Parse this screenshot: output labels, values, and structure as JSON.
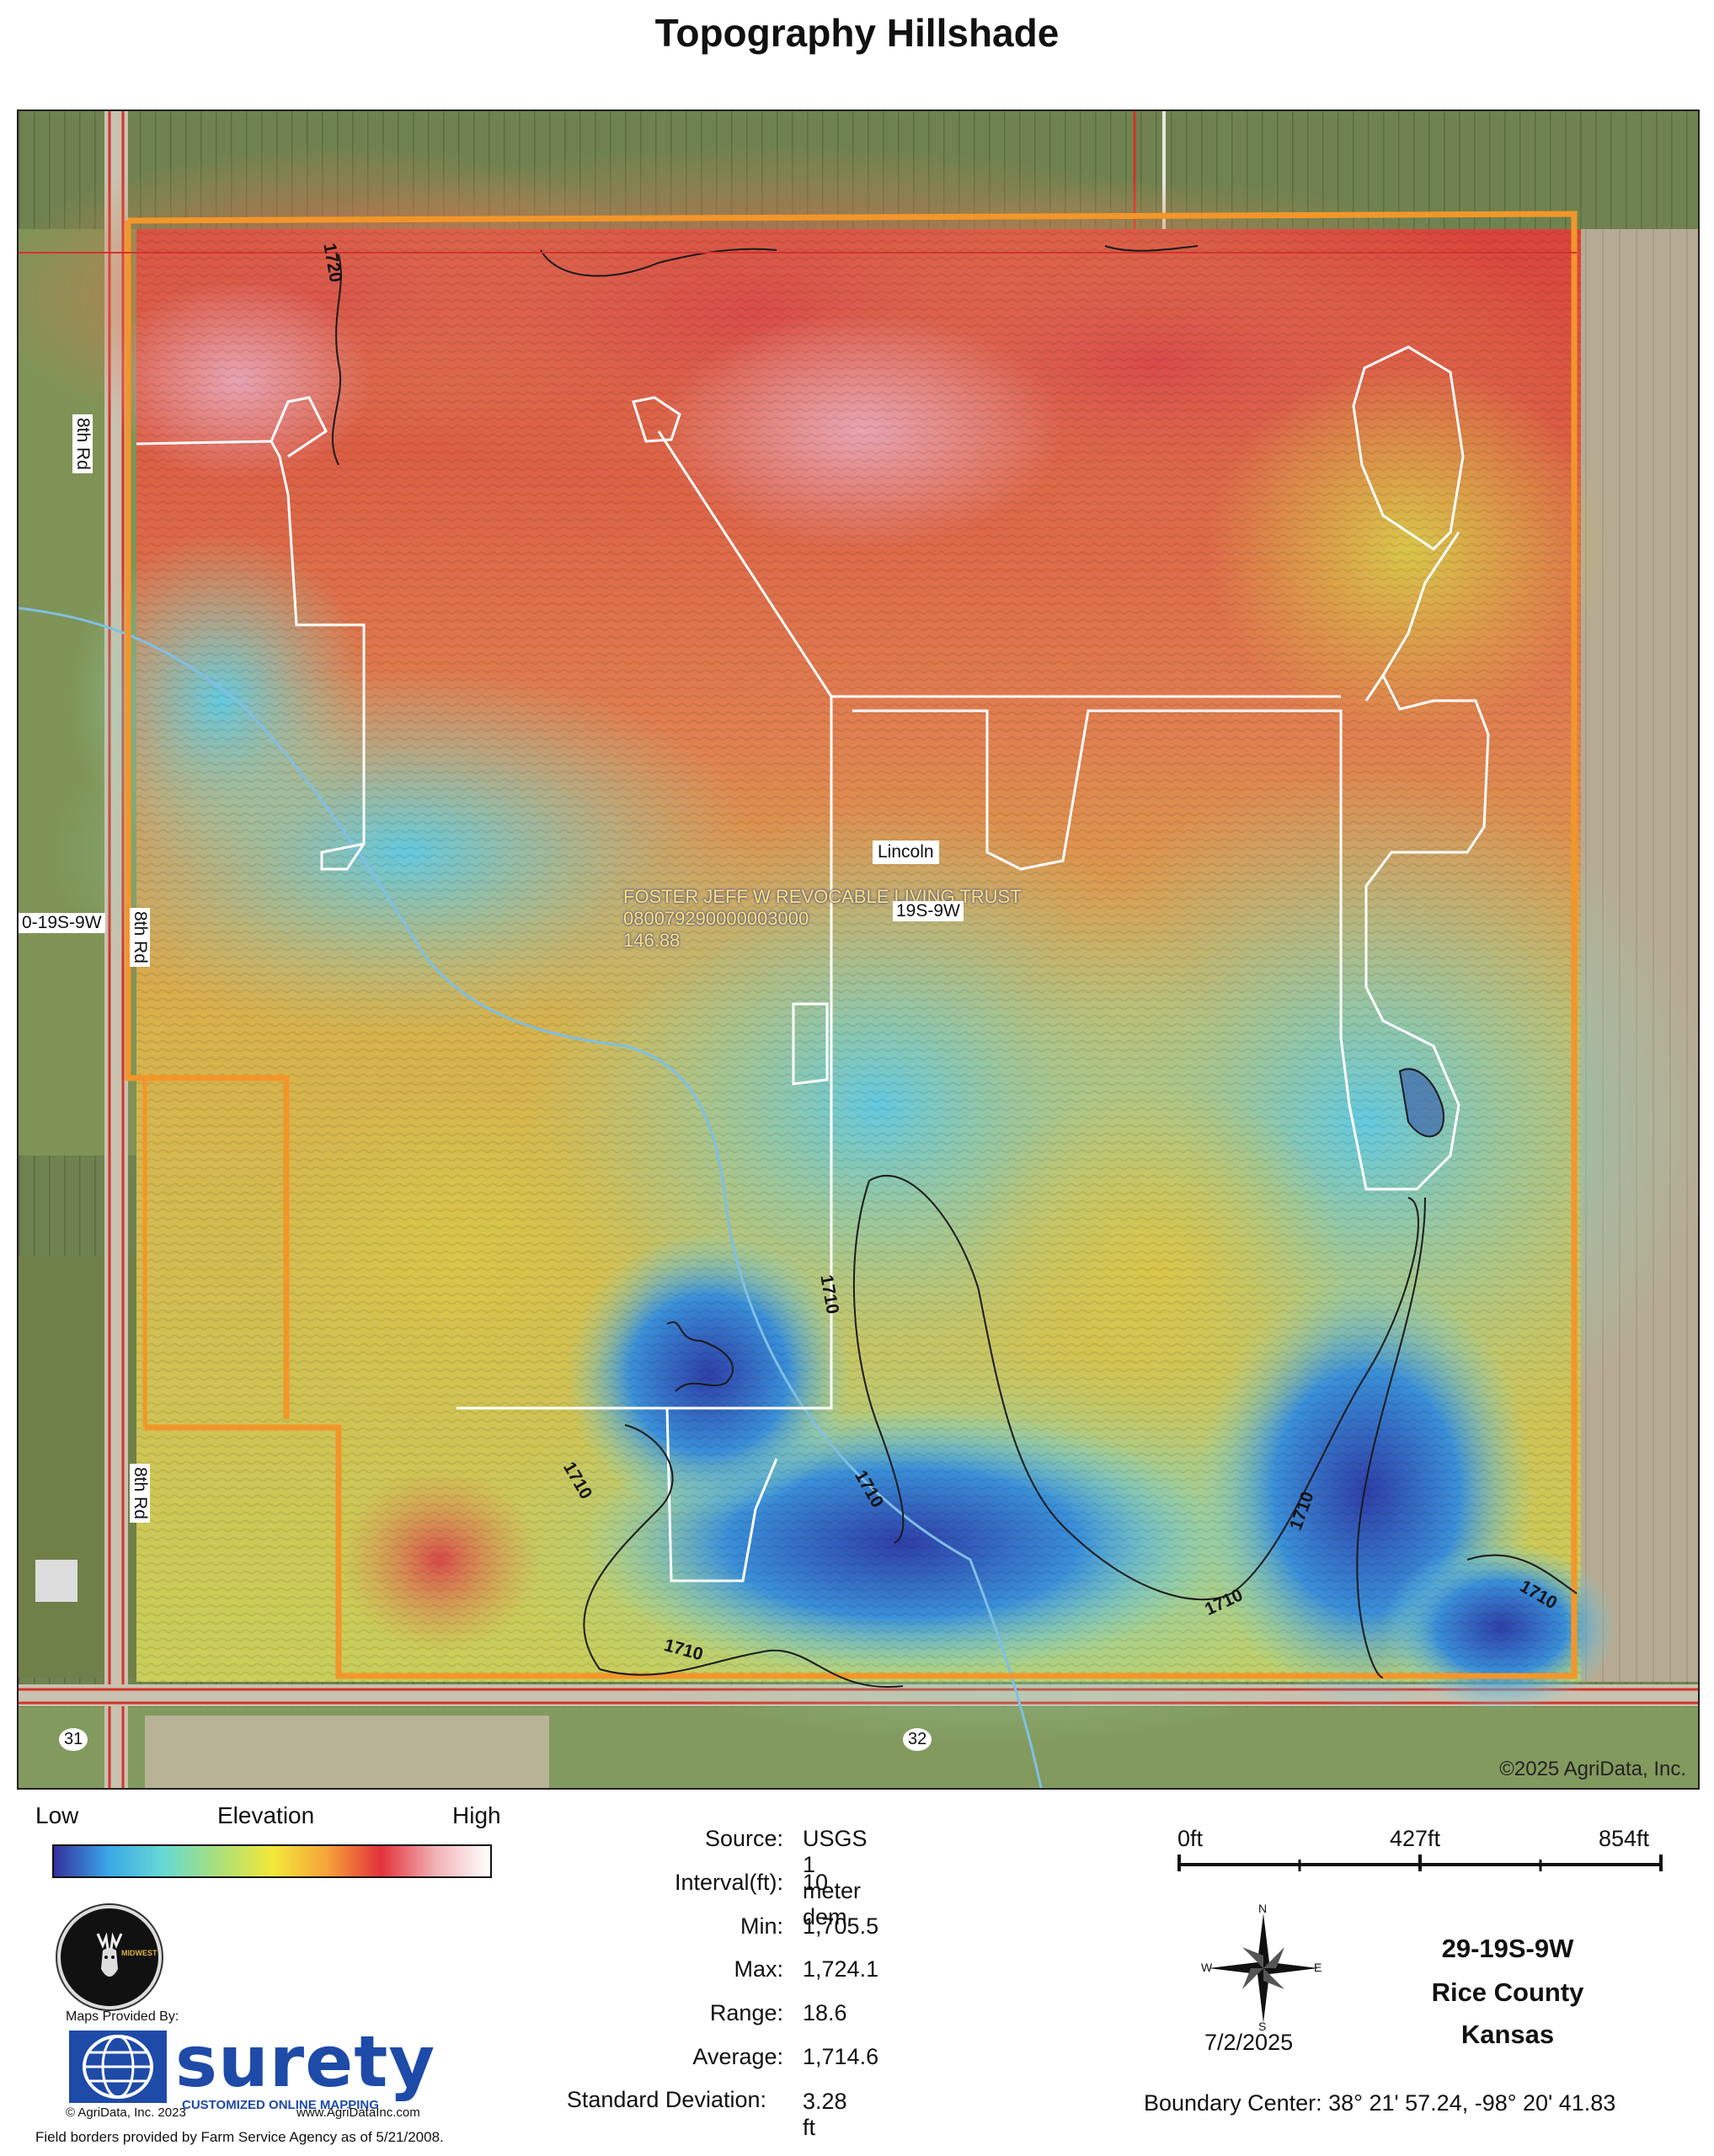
{
  "title": "Topography Hillshade",
  "map": {
    "owner_name": "FOSTER JEFF W REVOCABLE LIVING TRUST",
    "parcel_id": "080079290000003000",
    "acres": "146.88",
    "township_label": "Lincoln",
    "section_label": "19S-9W",
    "left_section_label": "0-19S-9W",
    "road_8th_top": "8th Rd",
    "road_8th_mid": "8th Rd",
    "road_8th_bottom": "8th Rd",
    "road_31": "31",
    "road_32": "32",
    "contour_label": "1710",
    "contour_label_top": "1720",
    "copyright": "©2025 AgriData, Inc."
  },
  "legend": {
    "low": "Low",
    "title": "Elevation",
    "high": "High",
    "colors": [
      "#33319e",
      "#3aa7e6",
      "#66d9d6",
      "#a8e07a",
      "#f2e83a",
      "#f7a43a",
      "#e2323a",
      "#f2b2b6",
      "#ffffff"
    ]
  },
  "stats": [
    {
      "key": "Source:",
      "value": "USGS 1 meter dem"
    },
    {
      "key": "Interval(ft):",
      "value": "10"
    },
    {
      "key": "Min:",
      "value": "1,705.5"
    },
    {
      "key": "Max:",
      "value": "1,724.1"
    },
    {
      "key": "Range:",
      "value": "18.6"
    },
    {
      "key": "Average:",
      "value": "1,714.6"
    },
    {
      "key": "Standard Deviation:",
      "value": "3.28 ft"
    }
  ],
  "scale": {
    "l0": "0ft",
    "l1": "427ft",
    "l2": "854ft"
  },
  "compass": {
    "n": "N",
    "s": "S",
    "e": "E",
    "w": "W"
  },
  "date": "7/2/2025",
  "location": {
    "section": "29-19S-9W",
    "county": "Rice County",
    "state": "Kansas"
  },
  "boundary_center": "Boundary Center: 38° 21' 57.24, -98° 20' 41.83",
  "logo_text": "MIDWEST",
  "maps_provided": "Maps Provided By:",
  "surety_word": "surety",
  "surety_tag": "CUSTOMIZED ONLINE MAPPING",
  "agridata_copyright": "© AgriData, Inc. 2023",
  "agridata_url": "www.AgriDataInc.com",
  "field_borders": "Field borders provided by Farm Service Agency as of 5/21/2008."
}
